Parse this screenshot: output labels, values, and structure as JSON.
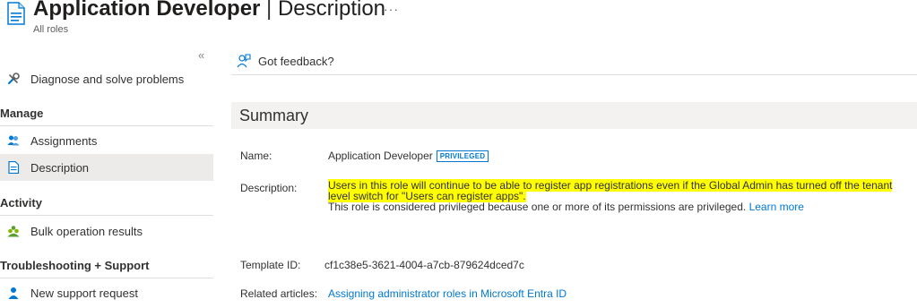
{
  "header": {
    "title_bold": "Application Developer",
    "title_separator": " | ",
    "title_rest": "Description",
    "ellipsis": "···",
    "breadcrumb": "All roles",
    "icon": "document-icon"
  },
  "sidebar": {
    "collapse_glyph": "«",
    "items": [
      {
        "label": "Diagnose and solve problems",
        "icon": "wrench-icon"
      },
      {
        "label": "Assignments",
        "icon": "people-icon"
      },
      {
        "label": "Description",
        "icon": "document-icon",
        "active": true
      },
      {
        "label": "Bulk operation results",
        "icon": "bulk-people-icon"
      },
      {
        "label": "New support request",
        "icon": "support-person-icon"
      }
    ],
    "sections": {
      "manage": "Manage",
      "activity": "Activity",
      "troubleshooting": "Troubleshooting + Support"
    }
  },
  "toolbar": {
    "feedback_label": "Got feedback?",
    "feedback_icon": "feedback-icon"
  },
  "summary": {
    "heading": "Summary",
    "name_label": "Name:",
    "name_value": "Application Developer",
    "badge": "PRIVILEGED",
    "description_label": "Description:",
    "description_line1": "Users in this role will continue to be able to register app registrations even if the Global Admin has turned off the tenant",
    "description_line2": "level switch for \"Users can register apps\".",
    "description_line3": "This role is considered privileged because one or more of its permissions are privileged.",
    "learn_more": "Learn more",
    "template_label": "Template ID:",
    "template_value": "cf1c38e5-3621-4004-a7cb-879624dced7c",
    "related_label": "Related articles:",
    "related_link": "Assigning administrator roles in Microsoft Entra ID"
  },
  "colors": {
    "accent": "#0078d4",
    "highlight": "#ffff00",
    "active_bg": "#edebe9",
    "summary_bg": "#f3f2f1"
  }
}
